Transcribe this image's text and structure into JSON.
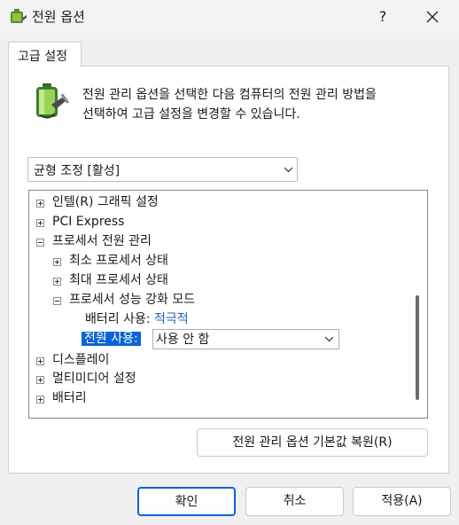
{
  "window": {
    "title": "전원 옵션",
    "help_label": "?",
    "icons": {
      "app": "power-options-icon",
      "close": "close-icon"
    }
  },
  "tabs": [
    {
      "label": "고급 설정",
      "selected": true
    }
  ],
  "description": {
    "line1": "전원 관리 옵션을 선택한 다음 컴퓨터의 전원 관리 방법을",
    "line2": "선택하여 고급 설정을 변경할 수 있습니다.",
    "icon": "battery-plug-icon"
  },
  "plan_select": {
    "value": "균형 조정 [활성]"
  },
  "tree": {
    "items": [
      {
        "label": "인텔(R) 그래픽 설정",
        "expander": "+"
      },
      {
        "label": "PCI Express",
        "expander": "+"
      },
      {
        "label": "프로세서 전원 관리",
        "expander": "-"
      },
      {
        "label": "최소 프로세서 상태",
        "expander": "+"
      },
      {
        "label": "최대 프로세서 상태",
        "expander": "+"
      },
      {
        "label": "프로세서 성능 강화 모드",
        "expander": "-"
      },
      {
        "label": "디스플레이",
        "expander": "+"
      },
      {
        "label": "멀티미디어 설정",
        "expander": "+"
      },
      {
        "label": "배터리",
        "expander": "+"
      }
    ],
    "battery_setting": {
      "label": "배터리 사용:",
      "value": "적극적"
    },
    "ac_setting": {
      "label": "전원 사용:",
      "value": "사용 안 함"
    },
    "accent_color": "#0a64d6"
  },
  "buttons": {
    "restore": "전원 관리 옵션 기본값 복원(R)",
    "ok": "확인",
    "cancel": "취소",
    "apply": "적용(A)"
  }
}
